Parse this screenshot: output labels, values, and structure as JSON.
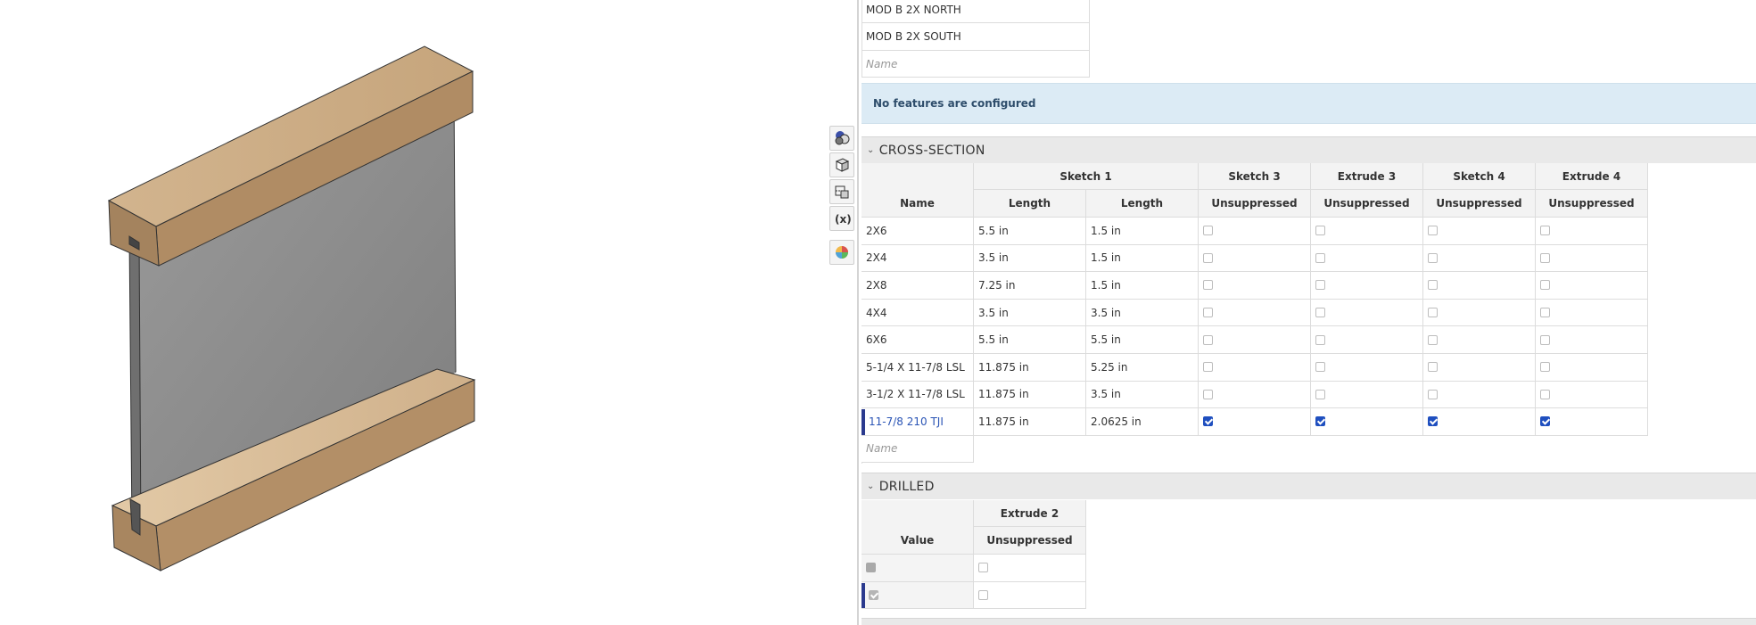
{
  "toolbar": {
    "icons": [
      "appearance-icon",
      "view-cube-icon",
      "section-view-icon",
      "configuration-variable-icon",
      "render-palette-icon"
    ]
  },
  "top_list": {
    "rows": [
      "MOD B 2X NORTH",
      "MOD B 2X SOUTH"
    ],
    "name_placeholder": "Name"
  },
  "banner": {
    "text": "No features are configured"
  },
  "cross_section": {
    "title": "CROSS-SECTION",
    "group_headers": [
      "Sketch 1",
      "Sketch 3",
      "Extrude 3",
      "Sketch 4",
      "Extrude 4"
    ],
    "name_header": "Name",
    "sub_headers": [
      "Length",
      "Length",
      "Unsuppressed",
      "Unsuppressed",
      "Unsuppressed",
      "Unsuppressed"
    ],
    "rows": [
      {
        "name": "2X6",
        "len1": "5.5 in",
        "len2": "1.5 in",
        "checks": [
          false,
          false,
          false,
          false
        ]
      },
      {
        "name": "2X4",
        "len1": "3.5 in",
        "len2": "1.5 in",
        "checks": [
          false,
          false,
          false,
          false
        ]
      },
      {
        "name": "2X8",
        "len1": "7.25 in",
        "len2": "1.5 in",
        "checks": [
          false,
          false,
          false,
          false
        ]
      },
      {
        "name": "4X4",
        "len1": "3.5 in",
        "len2": "3.5 in",
        "checks": [
          false,
          false,
          false,
          false
        ]
      },
      {
        "name": "6X6",
        "len1": "5.5 in",
        "len2": "5.5 in",
        "checks": [
          false,
          false,
          false,
          false
        ]
      },
      {
        "name": "5-1/4 X 11-7/8 LSL",
        "len1": "11.875 in",
        "len2": "5.25 in",
        "checks": [
          false,
          false,
          false,
          false
        ]
      },
      {
        "name": "3-1/2 X 11-7/8 LSL",
        "len1": "11.875 in",
        "len2": "3.5 in",
        "checks": [
          false,
          false,
          false,
          false
        ]
      },
      {
        "name": "11-7/8 210 TJI",
        "len1": "11.875 in",
        "len2": "2.0625 in",
        "checks": [
          true,
          true,
          true,
          true
        ],
        "selected": true
      }
    ],
    "name_placeholder": "Name"
  },
  "drilled": {
    "title": "DRILLED",
    "group_header": "Extrude 2",
    "value_header": "Value",
    "sub_header": "Unsuppressed",
    "rows": [
      {
        "value": false,
        "check": false
      },
      {
        "value": true,
        "check": false,
        "selected": true
      }
    ]
  },
  "colors": {
    "accent": "#1f4fbf",
    "selection_bar": "#2b3a8e",
    "banner_bg": "#dcebf5",
    "wood": "#c8a883",
    "web": "#8f8f8f"
  }
}
